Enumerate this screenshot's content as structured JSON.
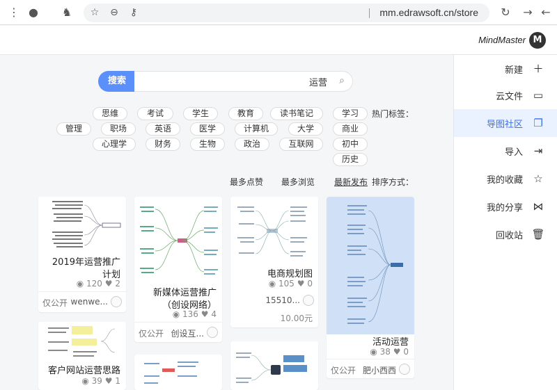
{
  "browser": {
    "url": "mm.edrawsoft.cn/store",
    "back_icon": "arrow-left-icon",
    "forward_icon": "arrow-right-icon",
    "reload_icon": "reload-icon"
  },
  "app": {
    "logo_text": "MindMaster",
    "logo_mark": "M"
  },
  "sidebar": {
    "items": [
      {
        "label": "新建",
        "icon": "＋"
      },
      {
        "label": "云文件",
        "icon": "▭"
      },
      {
        "label": "导图社区",
        "icon": "❐"
      },
      {
        "label": "导入",
        "icon": "⇥"
      },
      {
        "label": "我的收藏",
        "icon": "☆"
      },
      {
        "label": "我的分享",
        "icon": "⋈"
      },
      {
        "label": "回收站",
        "icon": "🗑"
      }
    ]
  },
  "search": {
    "button_label": "搜索",
    "value": "运营"
  },
  "tags": {
    "label": "热门标签：",
    "items": [
      "学习",
      "读书笔记",
      "教育",
      "学生",
      "考试",
      "思维",
      "商业",
      "大学",
      "计算机",
      "医学",
      "英语",
      "职场",
      "管理",
      "初中",
      "互联网",
      "政治",
      "生物",
      "财务",
      "心理学",
      "历史"
    ]
  },
  "sort": {
    "label": "排序方式：",
    "options": [
      "最新发布",
      "最多浏览",
      "最多点赞"
    ]
  },
  "cards": [
    {
      "title": "活动运营",
      "views": "38",
      "likes": "0",
      "price": "",
      "author": "肥小西西",
      "visibility": "仅公开"
    },
    {
      "title": "电商规划图",
      "views": "105",
      "likes": "0",
      "price": "10.00元",
      "author": "15510...",
      "visibility": ""
    },
    {
      "title": "新媒体运营推广（创设网络）",
      "views": "136",
      "likes": "4",
      "price": "",
      "author": "创设互...",
      "visibility": "仅公开"
    },
    {
      "title": "2019年运营推广计划",
      "views": "120",
      "likes": "2",
      "price": "",
      "author": "wenwe...",
      "visibility": "仅公开"
    },
    {
      "title": "客户网站运营思路",
      "views": "39",
      "likes": "1",
      "price": "",
      "author": "",
      "visibility": ""
    }
  ],
  "colors": {
    "accent": "#3b70f0",
    "search_button": "#5b8ff9",
    "thumb_highlight": "#cfe0f7"
  }
}
